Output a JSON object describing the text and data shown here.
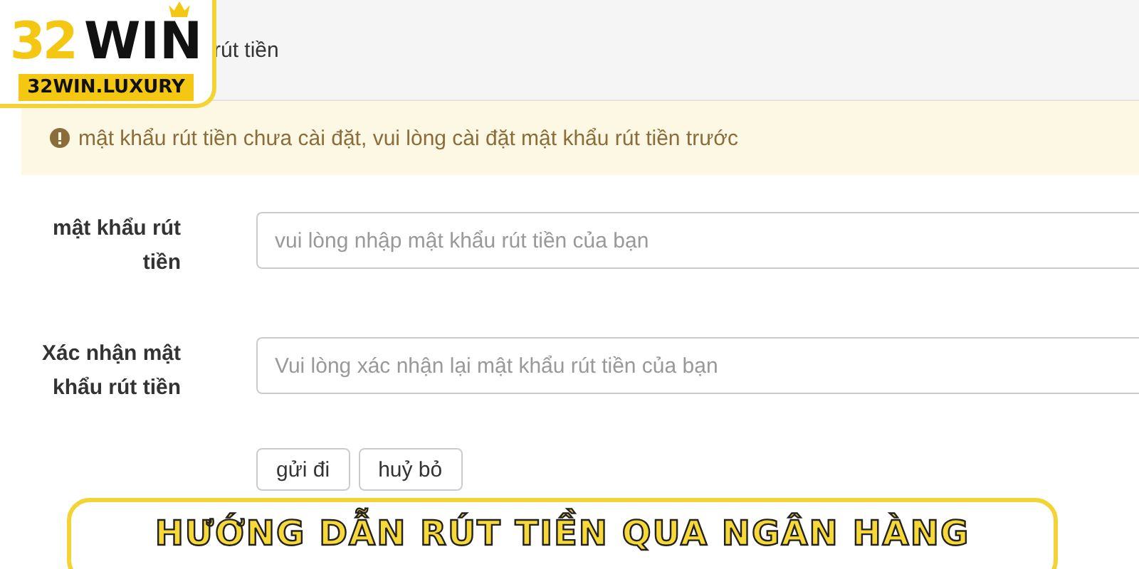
{
  "logo": {
    "number": "32",
    "word": "WIN",
    "domain": "32WIN.LUXURY"
  },
  "header": {
    "title": "rút tiền"
  },
  "alert": {
    "text": "mật khẩu rút tiền chưa cài đặt, vui lòng cài đặt mật khẩu rút tiền trước"
  },
  "fields": [
    {
      "label": "mật khẩu rút tiền",
      "placeholder": "vui lòng nhập mật khẩu rút tiền của bạn"
    },
    {
      "label": "Xác nhận mật khẩu rút tiền",
      "placeholder": "Vui lòng xác nhận lại mật khẩu rút tiền của bạn"
    }
  ],
  "buttons": [
    "gửi đi",
    "huỷ bỏ"
  ],
  "banner": {
    "title": "HƯỚNG DẪN RÚT TIỀN QUA NGÂN HÀNG"
  }
}
